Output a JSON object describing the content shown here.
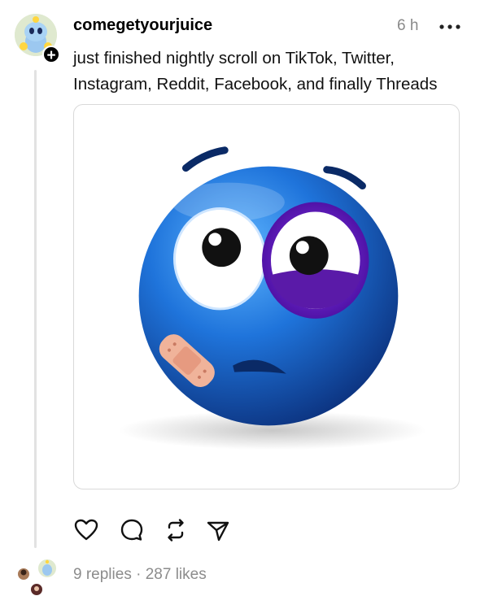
{
  "post": {
    "username": "comegetyourjuice",
    "timestamp": "6 h",
    "text": "just finished nightly scroll on TikTok, Twitter, Instagram, Reddit, Facebook, and finally Threads",
    "follow_glyph": "+"
  },
  "icons": {
    "more": "more-horizontal-icon",
    "like": "heart-icon",
    "reply": "comment-bubble-icon",
    "repost": "repost-arrows-icon",
    "share": "send-paper-plane-icon"
  },
  "footer": {
    "replies": "9 replies",
    "separator": "·",
    "likes": "287 likes"
  },
  "colors": {
    "text": "#000000",
    "muted": "#8c8c8c",
    "border": "#d9d9d9",
    "emoji_blue": "#1f6fd6",
    "bruise_purple": "#6a1fb8"
  }
}
